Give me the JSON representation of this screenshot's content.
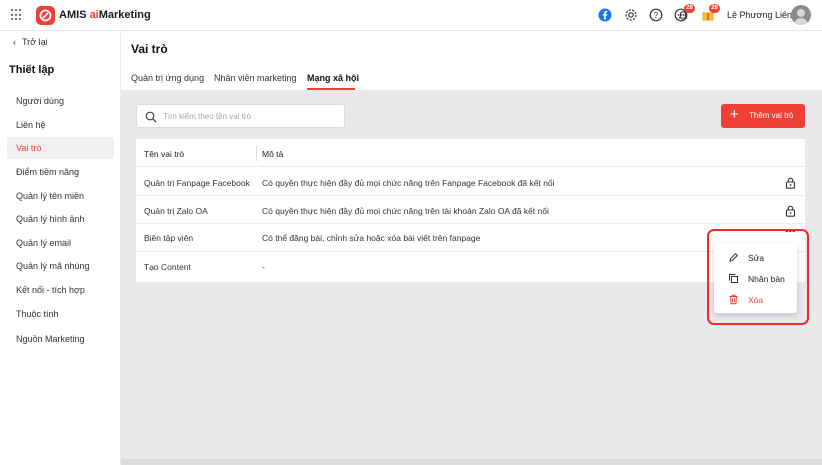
{
  "topbar": {
    "brand_prefix": "AMIS ",
    "brand_ai": "ai",
    "brand_suffix": "Marketing",
    "notification_count": "28",
    "gift_count": "28",
    "username": "Lê Phương Liên"
  },
  "sidebar": {
    "back_label": "Trở lại",
    "title": "Thiết lập",
    "items": [
      {
        "label": "Người dùng"
      },
      {
        "label": "Liên hệ"
      },
      {
        "label": "Vai trò"
      },
      {
        "label": "Điểm tiềm năng"
      },
      {
        "label": "Quản lý tên miền"
      },
      {
        "label": "Quản lý hình ảnh"
      },
      {
        "label": "Quản lý email"
      },
      {
        "label": "Quản lý mã nhúng"
      },
      {
        "label": "Kết nối - tích hợp"
      },
      {
        "label": "Thuộc tính"
      },
      {
        "label": "Nguồn Marketing"
      }
    ],
    "active_item": "Vai trò"
  },
  "page": {
    "title": "Vai trò",
    "tabs": [
      {
        "label": "Quản trị ứng dụng"
      },
      {
        "label": "Nhân viên marketing"
      },
      {
        "label": "Mạng xã hội"
      }
    ],
    "active_tab": "Mạng xã hội"
  },
  "search": {
    "placeholder": "Tìm kiếm theo tên vai trò",
    "value": ""
  },
  "add_button": {
    "label": "Thêm vai trò"
  },
  "table": {
    "columns": [
      "Tên vai trò",
      "Mô tả"
    ],
    "rows": [
      {
        "name": "Quản trị Fanpage Facebook",
        "description": "Có quyền thực hiện đầy đủ mọi chức năng trên Fanpage Facebook đã kết nối",
        "locked": true
      },
      {
        "name": "Quản trị Zalo OA",
        "description": "Có quyền thực hiện đầy đủ mọi chức năng trên tài khoản Zalo OA đã kết nối",
        "locked": true
      },
      {
        "name": "Biên tập viên",
        "description": "Có thể đăng bài, chỉnh sửa hoặc xóa bài viết trên fanpage",
        "locked": false
      },
      {
        "name": "Tạo Content",
        "description": "-",
        "locked": false
      }
    ]
  },
  "row_menu": {
    "more_label": "•••",
    "items": [
      {
        "label": "Sửa",
        "icon": "pencil-icon"
      },
      {
        "label": "Nhân bản",
        "icon": "duplicate-icon"
      },
      {
        "label": "Xóa",
        "icon": "trash-icon"
      }
    ]
  },
  "colors": {
    "accent": "#ef4036",
    "highlight": "#ef2b2b",
    "background": "#e9e9ec"
  }
}
